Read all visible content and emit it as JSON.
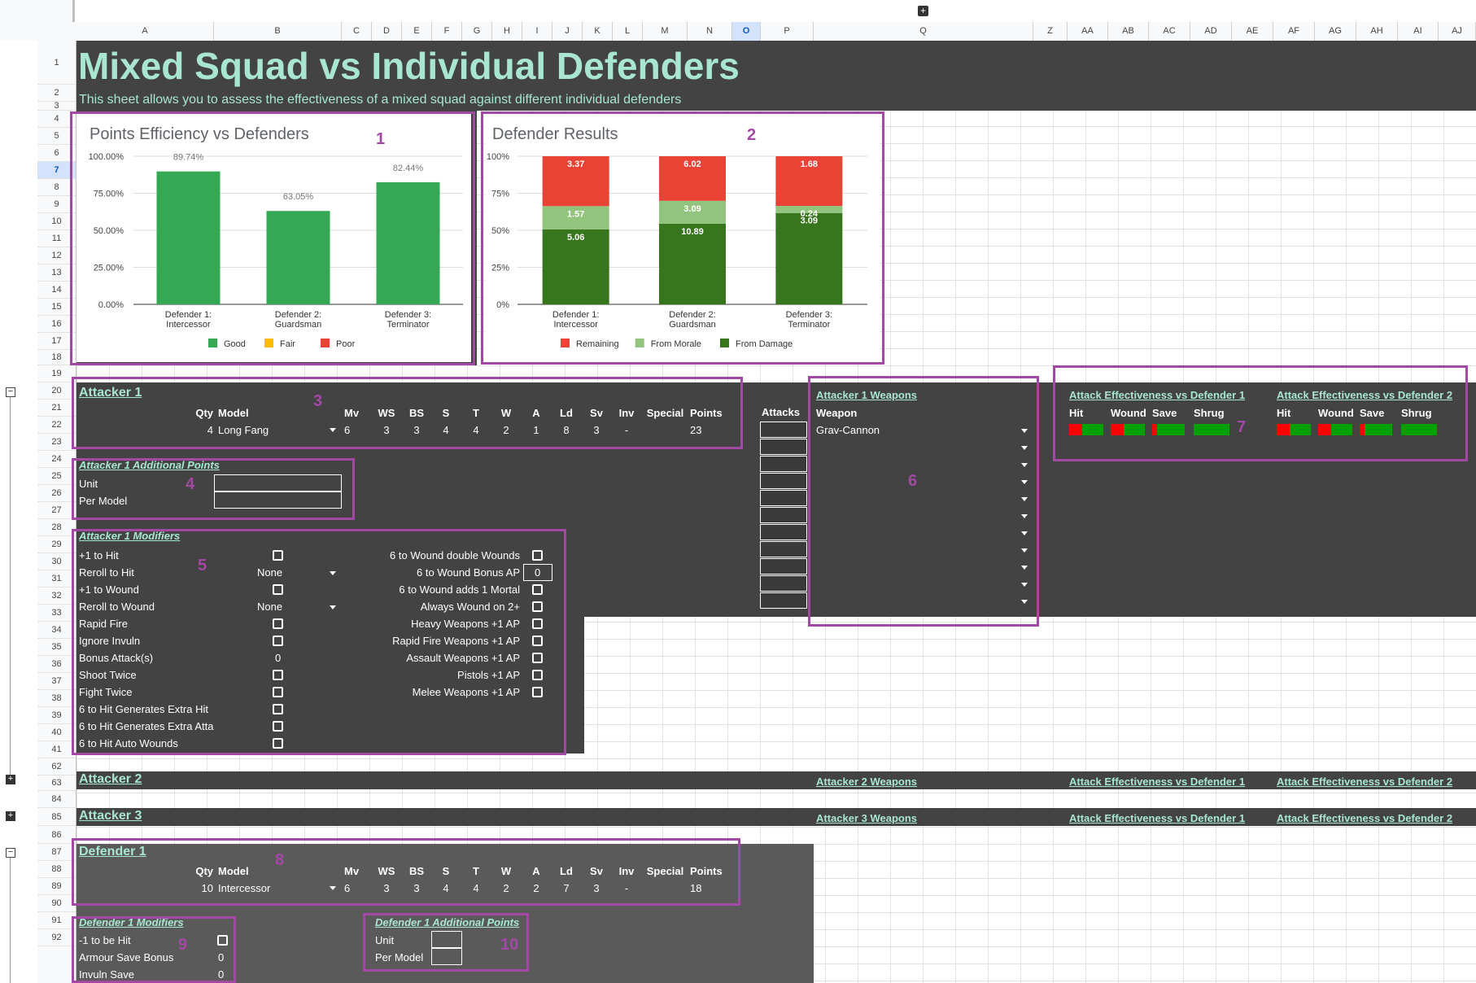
{
  "sheet": {
    "title": "Mixed Squad vs Individual Defenders",
    "subtitle": "This sheet allows you to assess the effectiveness of a mixed squad against different individual defenders",
    "columns": [
      "A",
      "B",
      "C",
      "D",
      "E",
      "F",
      "G",
      "H",
      "I",
      "J",
      "K",
      "L",
      "M",
      "N",
      "O",
      "P",
      "Q",
      "Z",
      "AA",
      "AB",
      "AC",
      "AD",
      "AE",
      "AF",
      "AG",
      "AH",
      "AI",
      "AJ"
    ],
    "selected_column": "O",
    "rows": [
      "1",
      "2",
      "3",
      "4",
      "5",
      "6",
      "7",
      "8",
      "9",
      "10",
      "11",
      "12",
      "13",
      "14",
      "15",
      "16",
      "17",
      "18",
      "19",
      "20",
      "21",
      "22",
      "23",
      "24",
      "25",
      "26",
      "27",
      "28",
      "29",
      "30",
      "31",
      "32",
      "33",
      "34",
      "35",
      "36",
      "37",
      "38",
      "39",
      "40",
      "41",
      "62",
      "63",
      "84",
      "85",
      "86",
      "87",
      "88",
      "89",
      "90",
      "91",
      "92"
    ],
    "selected_row": "7",
    "add_sheet_icon": "plus-box-icon"
  },
  "annotations": [
    "1",
    "2",
    "3",
    "4",
    "5",
    "6",
    "7",
    "8",
    "9",
    "10"
  ],
  "chart_data": [
    {
      "type": "bar",
      "title": "Points Efficiency vs Defenders",
      "categories": [
        "Defender 1: Intercessor",
        "Defender 2: Guardsman",
        "Defender 3: Terminator"
      ],
      "values": [
        89.74,
        63.05,
        82.44
      ],
      "data_labels": [
        "89.74%",
        "63.05%",
        "82.44%"
      ],
      "ylim": [
        0,
        100
      ],
      "yticks": [
        "0.00%",
        "25.00%",
        "50.00%",
        "75.00%",
        "100.00%"
      ],
      "bar_color": "#34a853",
      "legend": [
        {
          "name": "Good",
          "color": "#34a853"
        },
        {
          "name": "Fair",
          "color": "#fbbc04"
        },
        {
          "name": "Poor",
          "color": "#ea4335"
        }
      ],
      "legend_position": "bottom"
    },
    {
      "type": "bar",
      "stacked": "percent",
      "title": "Defender Results",
      "categories": [
        "Defender 1: Intercessor",
        "Defender 2: Guardsman",
        "Defender 3: Terminator"
      ],
      "yticks": [
        "0%",
        "25%",
        "50%",
        "75%",
        "100%"
      ],
      "series": [
        {
          "name": "From Damage",
          "color": "#38761d",
          "values": [
            5.06,
            10.89,
            3.09
          ]
        },
        {
          "name": "From Morale",
          "color": "#93c47d",
          "values": [
            1.57,
            3.09,
            0.24
          ]
        },
        {
          "name": "Remaining",
          "color": "#ea4335",
          "values": [
            3.37,
            6.02,
            1.68
          ]
        }
      ],
      "legend_position": "bottom"
    }
  ],
  "attacker1": {
    "title": "Attacker 1",
    "headers": [
      "Qty",
      "Model",
      "Mv",
      "WS",
      "BS",
      "S",
      "T",
      "W",
      "A",
      "Ld",
      "Sv",
      "Inv",
      "Special",
      "Points"
    ],
    "values": [
      "4",
      "Long Fang",
      "6",
      "3",
      "3",
      "4",
      "4",
      "2",
      "1",
      "8",
      "3",
      "-",
      "",
      "23"
    ]
  },
  "attacker1_points": {
    "title": "Attacker 1 Additional Points",
    "unit": "Unit",
    "per_model": "Per Model"
  },
  "attacker1_modifiers": {
    "title": "Attacker 1 Modifiers",
    "left": [
      {
        "label": "+1 to Hit",
        "type": "checkbox"
      },
      {
        "label": "Reroll to Hit",
        "type": "select",
        "value": "None"
      },
      {
        "label": "+1 to Wound",
        "type": "checkbox"
      },
      {
        "label": "Reroll to Wound",
        "type": "select",
        "value": "None"
      },
      {
        "label": "Rapid Fire",
        "type": "checkbox"
      },
      {
        "label": "Ignore Invuln",
        "type": "checkbox"
      },
      {
        "label": "Bonus Attack(s)",
        "type": "value",
        "value": "0"
      },
      {
        "label": "Shoot Twice",
        "type": "checkbox"
      },
      {
        "label": "Fight Twice",
        "type": "checkbox"
      },
      {
        "label": "6 to Hit Generates Extra Hit",
        "type": "checkbox"
      },
      {
        "label": "6 to Hit Generates Extra Atta",
        "type": "checkbox"
      },
      {
        "label": "6 to Hit Auto Wounds",
        "type": "checkbox"
      }
    ],
    "right": [
      {
        "label": "6 to Wound double Wounds",
        "type": "checkbox"
      },
      {
        "label": "6 to Wound Bonus AP",
        "type": "value",
        "value": "0"
      },
      {
        "label": "6 to Wound adds 1 Mortal",
        "type": "checkbox"
      },
      {
        "label": "Always Wound on 2+",
        "type": "checkbox"
      },
      {
        "label": "Heavy Weapons +1 AP",
        "type": "checkbox"
      },
      {
        "label": "Rapid Fire Weapons +1 AP",
        "type": "checkbox"
      },
      {
        "label": "Assault Weapons +1 AP",
        "type": "checkbox"
      },
      {
        "label": "Pistols +1 AP",
        "type": "checkbox"
      },
      {
        "label": "Melee Weapons +1 AP",
        "type": "checkbox"
      }
    ]
  },
  "attacker1_weapons": {
    "title": "Attacker 1 Weapons",
    "attacks_header": "Attacks",
    "weapon_header": "Weapon",
    "weapons": [
      "Grav-Cannon",
      "",
      "",
      "",
      "",
      "",
      "",
      "",
      "",
      "",
      ""
    ]
  },
  "effectiveness": {
    "d1_title": "Attack Effectiveness vs Defender 1",
    "d2_title": "Attack Effectiveness vs Defender 2",
    "headers": [
      "Hit",
      "Wound",
      "Save",
      "Shrug"
    ],
    "bad_color": "#ff0000",
    "good_color": "#00a000"
  },
  "attacker2": {
    "title": "Attacker 2",
    "weapons_title": "Attacker 2 Weapons",
    "eff1": "Attack Effectiveness vs Defender 1",
    "eff2": "Attack Effectiveness vs Defender 2"
  },
  "attacker3": {
    "title": "Attacker 3",
    "weapons_title": "Attacker 3 Weapons",
    "eff1": "Attack Effectiveness vs Defender 1",
    "eff2": "Attack Effectiveness vs Defender 2"
  },
  "defender1": {
    "title": "Defender 1",
    "headers": [
      "Qty",
      "Model",
      "Mv",
      "WS",
      "BS",
      "S",
      "T",
      "W",
      "A",
      "Ld",
      "Sv",
      "Inv",
      "Special",
      "Points"
    ],
    "values": [
      "10",
      "Intercessor",
      "6",
      "3",
      "3",
      "4",
      "4",
      "2",
      "2",
      "7",
      "3",
      "-",
      "",
      "18"
    ]
  },
  "defender1_modifiers": {
    "title": "Defender 1 Modifiers",
    "items": [
      {
        "label": "-1 to be Hit",
        "type": "checkbox"
      },
      {
        "label": "Armour Save Bonus",
        "type": "value",
        "value": "0"
      },
      {
        "label": "Invuln Save",
        "type": "value",
        "value": "0"
      }
    ]
  },
  "defender1_points": {
    "title": "Defender 1 Additional Points",
    "unit": "Unit",
    "per_model": "Per Model"
  }
}
